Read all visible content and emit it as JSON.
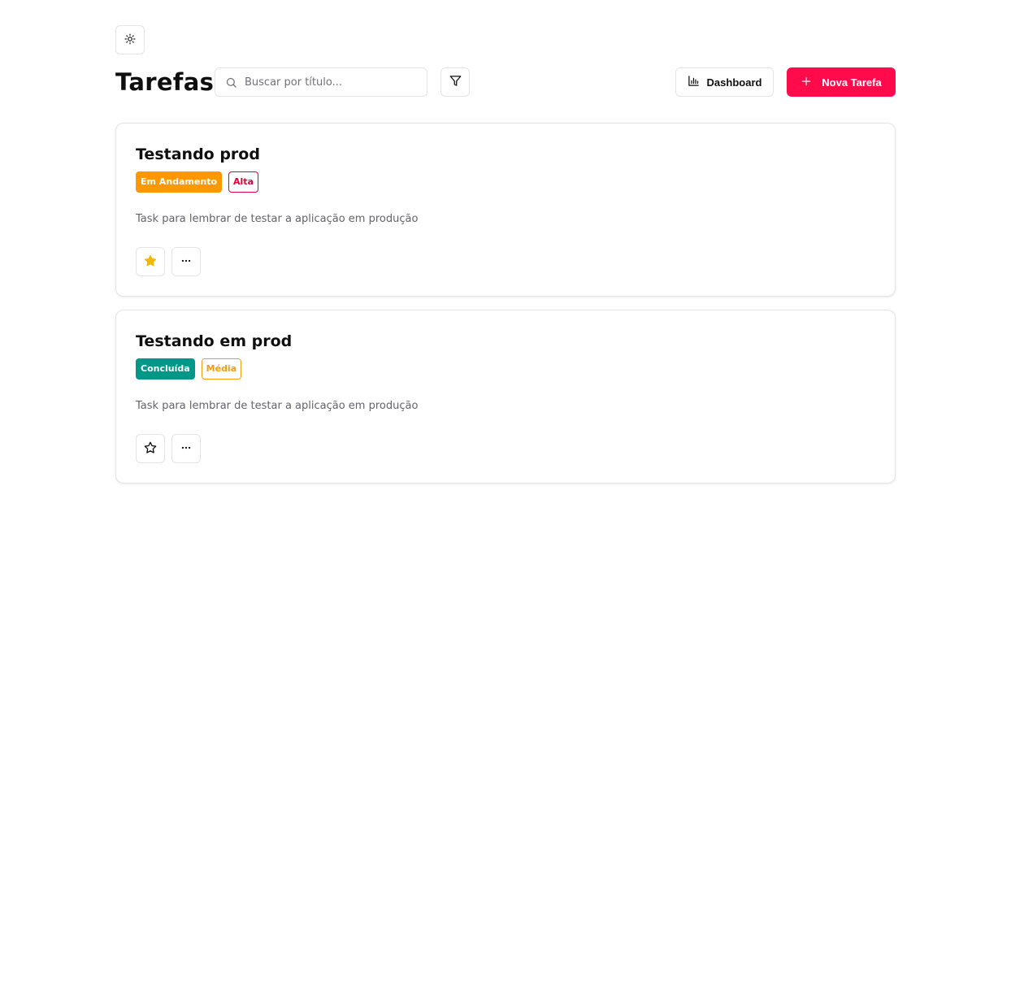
{
  "header": {
    "theme_icon": "sun-icon",
    "title": "Tarefas",
    "search": {
      "icon": "search-icon",
      "placeholder": "Buscar por título...",
      "value": ""
    },
    "filter_icon": "filter-icon",
    "dashboard_label": "Dashboard",
    "dashboard_icon": "bar-chart-icon",
    "new_task_label": "Nova Tarefa",
    "new_task_icon": "plus-icon"
  },
  "colors": {
    "accent": "#ff0a4a",
    "in_progress": "#ff9800",
    "done": "#009688",
    "high": "#e0003c",
    "medium": "#f59e0b",
    "star_filled": "#f5b800"
  },
  "tasks": [
    {
      "title": "Testando prod",
      "status": "Em Andamento",
      "status_color": "#ff9800",
      "priority": "Alta",
      "priority_color": "#e0003c",
      "description": "Task para lembrar de testar a aplicação em produção",
      "favorite": true,
      "favorite_icon": "star-filled-icon",
      "more_icon": "more-horizontal-icon"
    },
    {
      "title": "Testando em prod",
      "status": "Concluída",
      "status_color": "#009688",
      "priority": "Média",
      "priority_color": "#f59e0b",
      "description": "Task para lembrar de testar a aplicação em produção",
      "favorite": false,
      "favorite_icon": "star-outline-icon",
      "more_icon": "more-horizontal-icon"
    }
  ]
}
